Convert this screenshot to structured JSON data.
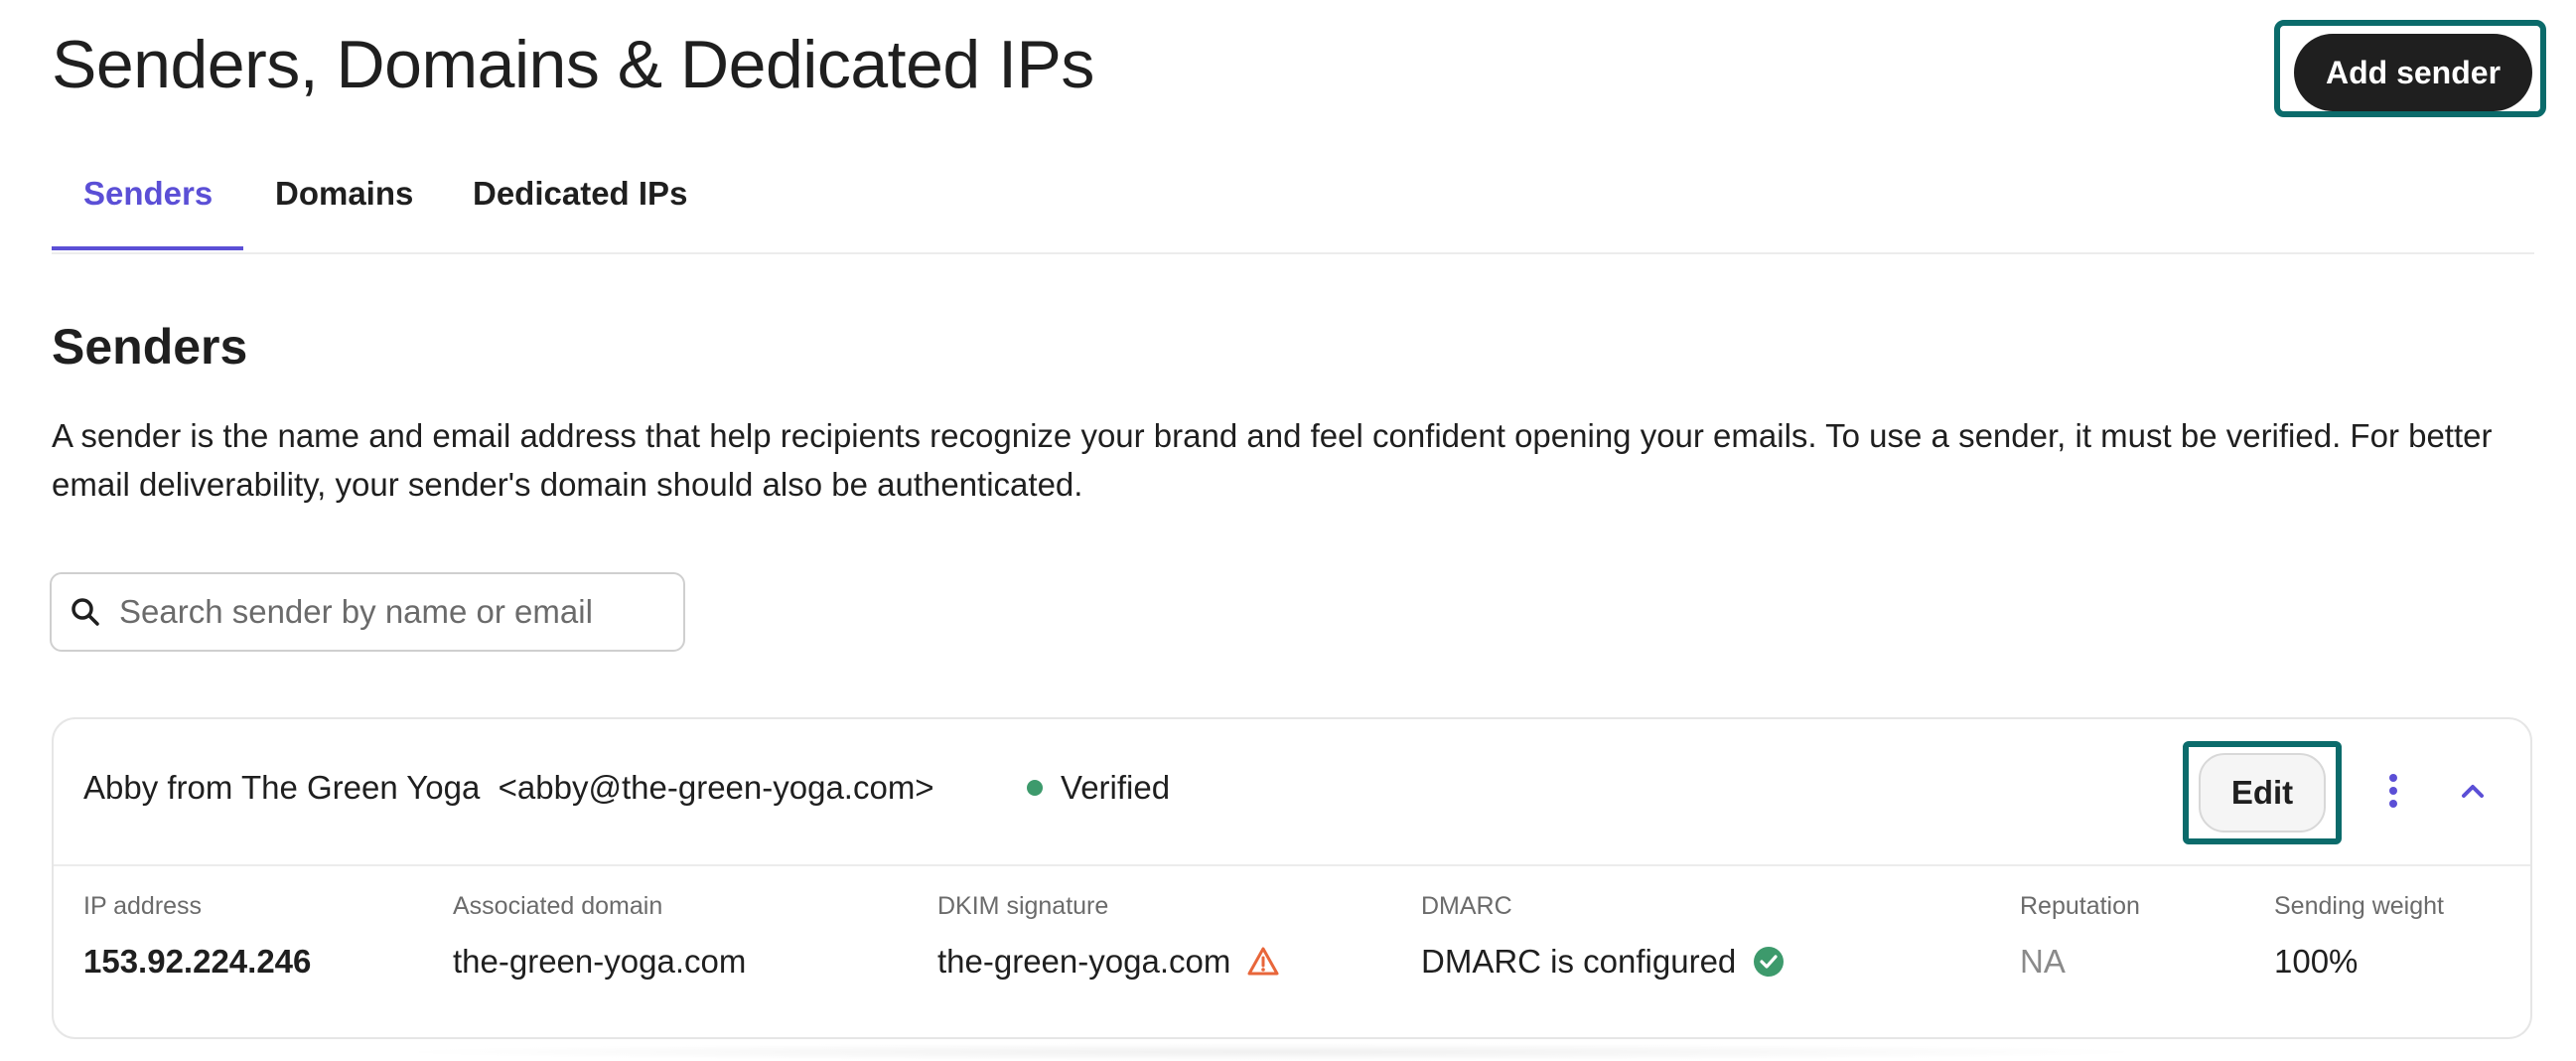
{
  "page": {
    "title": "Senders, Domains & Dedicated IPs",
    "add_sender_label": "Add sender"
  },
  "tabs": [
    {
      "label": "Senders",
      "active": true
    },
    {
      "label": "Domains",
      "active": false
    },
    {
      "label": "Dedicated IPs",
      "active": false
    }
  ],
  "section": {
    "title": "Senders",
    "description": "A sender is the name and email address that help recipients recognize your brand and feel confident opening your emails. To use a sender, it must be verified. For better email deliverability, your sender's domain should also be authenticated."
  },
  "search": {
    "placeholder": "Search sender by name or email",
    "value": ""
  },
  "sender": {
    "name": "Abby from The Green Yoga  <abby@the-green-yoga.com>",
    "status": "Verified",
    "status_color": "#3d9a6c",
    "edit_label": "Edit",
    "columns": [
      {
        "label": "IP address",
        "value": "153.92.224.246"
      },
      {
        "label": "Associated domain",
        "value": "the-green-yoga.com"
      },
      {
        "label": "DKIM signature",
        "value": "the-green-yoga.com",
        "icon": "warning-icon",
        "icon_color": "#e8663a"
      },
      {
        "label": "DMARC",
        "value": "DMARC is configured",
        "icon": "check-circle-icon",
        "icon_color": "#3d9a6c"
      },
      {
        "label": "Reputation",
        "value": "NA"
      },
      {
        "label": "Sending weight",
        "value": "100%"
      }
    ]
  },
  "colors": {
    "accent": "#5b4fd6",
    "focus_outline": "#0b6b6b",
    "primary_button": "#1f1f1f"
  }
}
